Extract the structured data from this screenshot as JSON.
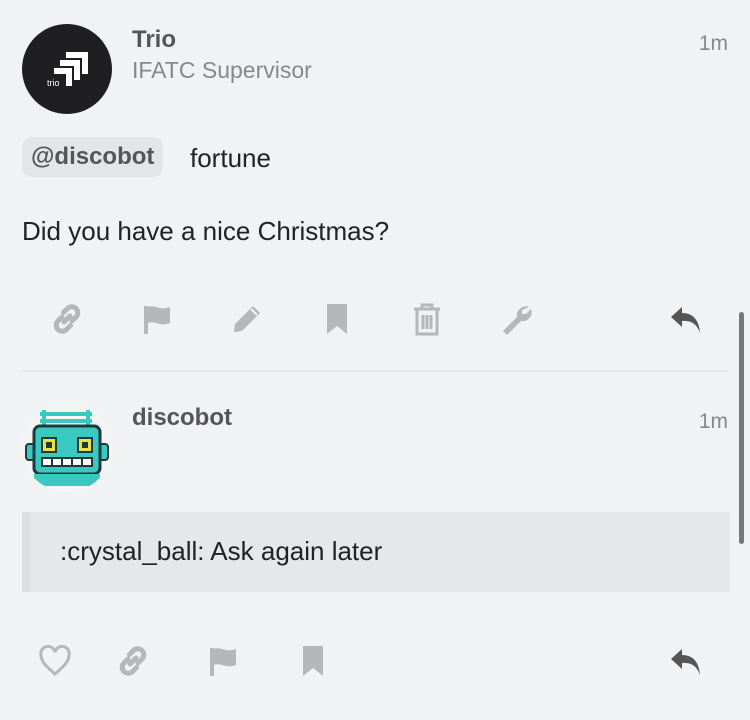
{
  "posts": [
    {
      "author": "Trio",
      "user_title": "IFATC Supervisor",
      "time": "1m",
      "avatar_text": "trio",
      "mention": "@discobot",
      "mention_rest": "fortune",
      "text": "Did you have a nice Christmas?",
      "actions": [
        "link-icon",
        "flag-icon",
        "edit-icon",
        "bookmark-icon",
        "delete-icon",
        "wrench-icon",
        "reply-icon"
      ]
    },
    {
      "author": "discobot",
      "time": "1m",
      "quote": ":crystal_ball: Ask again later",
      "actions": [
        "like-icon",
        "link-icon",
        "flag-icon",
        "bookmark-icon",
        "reply-icon"
      ]
    }
  ],
  "colors": {
    "background": "#f1f2f4",
    "icon": "#b5b7ba",
    "reply_icon": "#555555",
    "robot_teal": "#3ac9c0",
    "robot_eye": "#e7e24a"
  }
}
